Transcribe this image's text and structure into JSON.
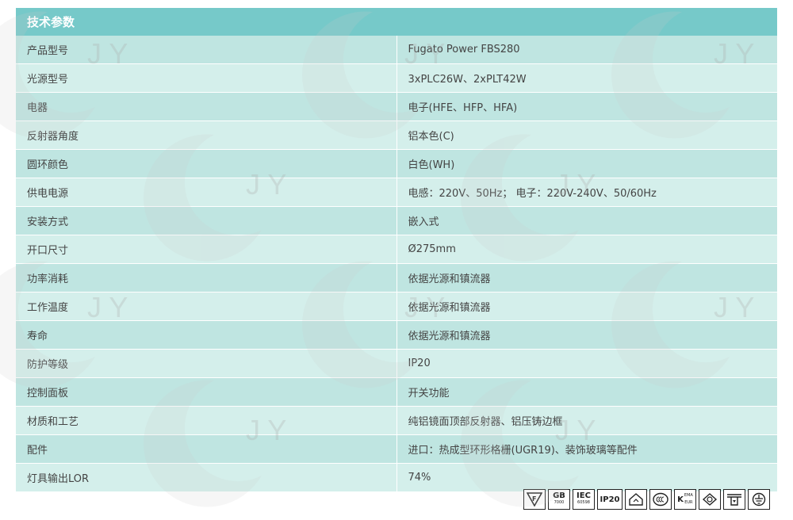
{
  "header": "技术参数",
  "rows": [
    {
      "label": "产品型号",
      "value": "Fugato Power FBS280"
    },
    {
      "label": "光源型号",
      "value": "3xPLC26W、2xPLT42W"
    },
    {
      "label": "电器",
      "value": "电子(HFE、HFP、HFA)"
    },
    {
      "label": "反射器角度",
      "value": "铝本色(C)"
    },
    {
      "label": "圆环颜色",
      "value": "白色(WH)"
    },
    {
      "label": "供电电源",
      "value": "电感：220V、50Hz； 电子：220V-240V、50/60Hz"
    },
    {
      "label": "安装方式",
      "value": "嵌入式"
    },
    {
      "label": "开口尺寸",
      "value": "Ø275mm"
    },
    {
      "label": "功率消耗",
      "value": "依据光源和镇流器"
    },
    {
      "label": "工作温度",
      "value": "依据光源和镇流器"
    },
    {
      "label": "寿命",
      "value": "依据光源和镇流器"
    },
    {
      "label": "防护等级",
      "value": "IP20"
    },
    {
      "label": "控制面板",
      "value": "开关功能"
    },
    {
      "label": "材质和工艺",
      "value": "纯铝镜面顶部反射器、铝压铸边框"
    },
    {
      "label": "配件",
      "value": "进口：热成型环形格栅(UGR19)、装饰玻璃等配件"
    },
    {
      "label": "灯具输出LOR",
      "value": "74%"
    }
  ],
  "certifications": {
    "gb": {
      "line1": "GB",
      "line2": "7000"
    },
    "iec": {
      "line1": "IEC",
      "line2": "60598"
    },
    "ip": "IP20",
    "k": {
      "main": "K",
      "sub1": "EMA",
      "sub2": "EUR"
    }
  },
  "watermark_text": "J Y",
  "colors": {
    "header_bg": "#76c9c9",
    "row_odd": "#bfe5e1",
    "row_even": "#d4efeb",
    "text": "#444444"
  }
}
